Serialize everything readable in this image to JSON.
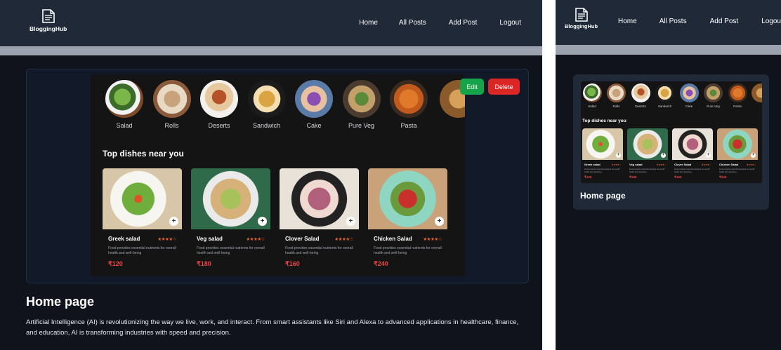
{
  "app": {
    "brand": "BloggingHub"
  },
  "nav": {
    "links": [
      "Home",
      "All Posts",
      "Add Post",
      "Logout"
    ]
  },
  "post": {
    "edit_label": "Edit",
    "delete_label": "Delete",
    "title": "Home page",
    "body": "Artificial Intelligence (AI) is revolutionizing the way we live, work, and interact. From smart assistants like Siri and Alexa to advanced applications in healthcare, finance, and education, AI is transforming industries with speed and precision."
  },
  "food_image": {
    "categories": [
      "Salad",
      "Rolls",
      "Deserts",
      "Sandwich",
      "Cake",
      "Pure Veg",
      "Pasta"
    ],
    "section_title": "Top dishes near you",
    "dishes": [
      {
        "name": "Greek salad",
        "rating": "★★★★☆",
        "rating_value": 4,
        "description": "Food provides essential nutrients for overall health and well-being",
        "price": "₹120"
      },
      {
        "name": "Veg salad",
        "rating": "★★★★☆",
        "rating_value": 4,
        "description": "Food provides essential nutrients for overall health and well-being",
        "price": "₹180"
      },
      {
        "name": "Clover Salad",
        "rating": "★★★★☆",
        "rating_value": 4,
        "description": "Food provides essential nutrients for overall health and well-being",
        "price": "₹160"
      },
      {
        "name": "Chicken Salad",
        "rating": "★★★★☆",
        "rating_value": 4,
        "description": "Food provides essential nutrients for overall health and well-being",
        "price": "₹240"
      }
    ]
  },
  "colors": {
    "nav_bg": "#1f2937",
    "page_bg": "#0f131c",
    "edit": "#16a34a",
    "delete": "#dc2626",
    "price": "#ef4444",
    "rating": "#ef6a2e"
  }
}
